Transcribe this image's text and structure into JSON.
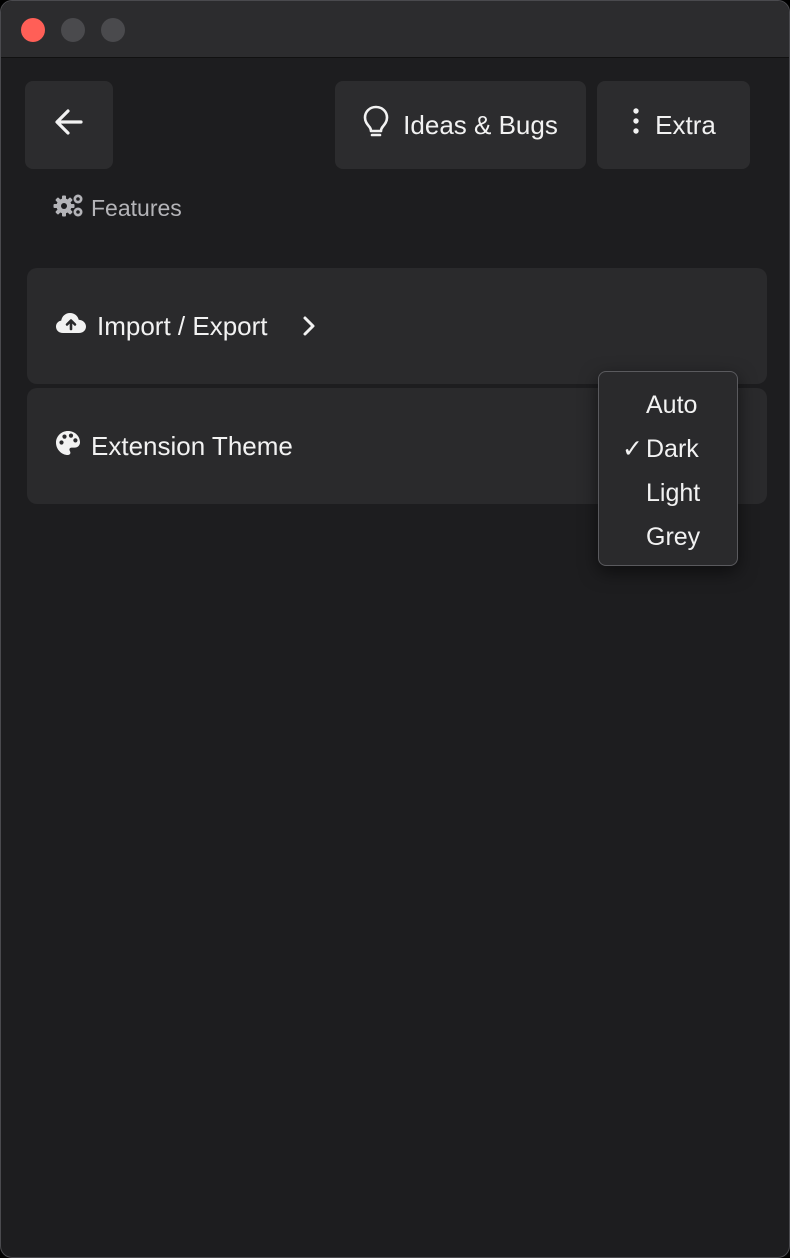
{
  "window": {
    "traffic_lights": {
      "close_color": "#ff5f57",
      "minimize_color": "#4a4a4d",
      "maximize_color": "#4a4a4d"
    }
  },
  "toolbar": {
    "back_icon": "arrow-left-icon",
    "ideas_icon": "lightbulb-icon",
    "ideas_label": "Ideas & Bugs",
    "extra_icon": "vertical-dots-icon",
    "extra_label": "Extra"
  },
  "section": {
    "icon": "gears-icon",
    "label": "Features"
  },
  "rows": [
    {
      "icon": "cloud-upload-icon",
      "label": "Import / Export",
      "trailing_icon": "chevron-right-icon"
    },
    {
      "icon": "palette-icon",
      "label": "Extension Theme"
    }
  ],
  "theme_dropdown": {
    "options": [
      "Auto",
      "Dark",
      "Light",
      "Grey"
    ],
    "selected": "Dark",
    "check_glyph": "✓"
  },
  "colors": {
    "window_bg": "#1d1d1f",
    "titlebar_bg": "#2c2c2e",
    "button_bg": "#2c2c2e",
    "row_bg": "#2a2a2c",
    "text": "#f2f2f2",
    "muted_text": "#b4b4b8"
  }
}
